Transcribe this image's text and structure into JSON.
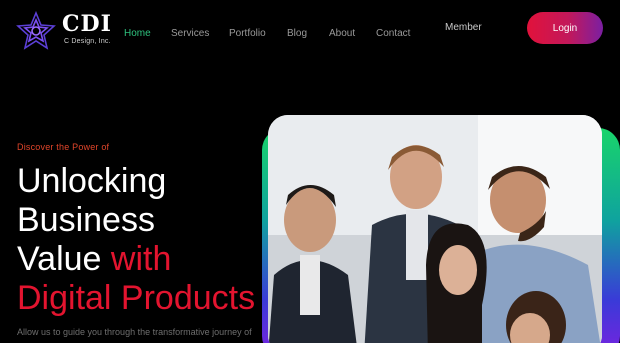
{
  "brand": {
    "name": "CDI",
    "tagline": "C Design, Inc."
  },
  "nav": {
    "items": [
      {
        "label": "Home",
        "active": true
      },
      {
        "label": "Services",
        "active": false
      },
      {
        "label": "Portfolio",
        "active": false
      },
      {
        "label": "Blog",
        "active": false
      },
      {
        "label": "About",
        "active": false
      },
      {
        "label": "Contact",
        "active": false
      }
    ],
    "member_label": "Member",
    "login_label": "Login"
  },
  "hero": {
    "eyebrow": "Discover the Power of",
    "headline_line1": "Unlocking",
    "headline_line2": "Business",
    "headline_line3_white": "Value",
    "headline_line3_red": "with",
    "headline_line4_red": "Digital Products",
    "subtext": "Allow us to guide you through the transformative journey of"
  },
  "colors": {
    "accent_red": "#e3142f",
    "nav_active": "#2ec27e",
    "login_gradient_start": "#e1123b",
    "login_gradient_end": "#7b1fa2"
  }
}
